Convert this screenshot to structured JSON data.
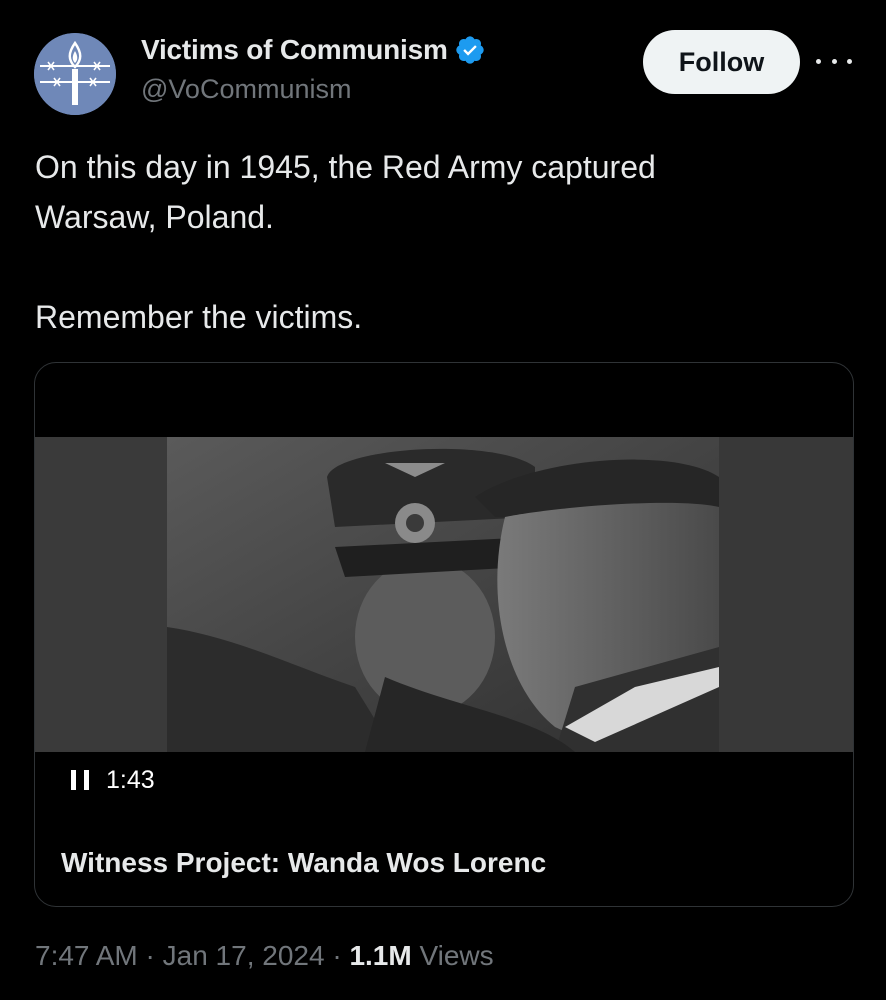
{
  "account": {
    "display_name": "Victims of Communism",
    "handle": "@VoCommunism",
    "verified": true,
    "avatar_icon": "torch-barbed-wire-logo"
  },
  "actions": {
    "follow_label": "Follow",
    "more_icon": "more-horizontal-icon"
  },
  "tweet": {
    "text_line1": "On this day in 1945, the Red Army captured Warsaw, Poland.",
    "text_line2": "Remember the victims."
  },
  "media": {
    "playback_icon": "pause-icon",
    "duration": "1:43",
    "title": "Witness Project: Wanda Wos Lorenc"
  },
  "meta": {
    "time": "7:47 AM",
    "separator": "·",
    "date": "Jan 17, 2024",
    "views_count": "1.1M",
    "views_label": "Views"
  },
  "colors": {
    "background": "#000000",
    "text_primary": "#e7e9ea",
    "text_secondary": "#71767b",
    "verified_blue": "#1d9bf0",
    "follow_bg": "#eff3f4",
    "border": "#2f3336"
  }
}
